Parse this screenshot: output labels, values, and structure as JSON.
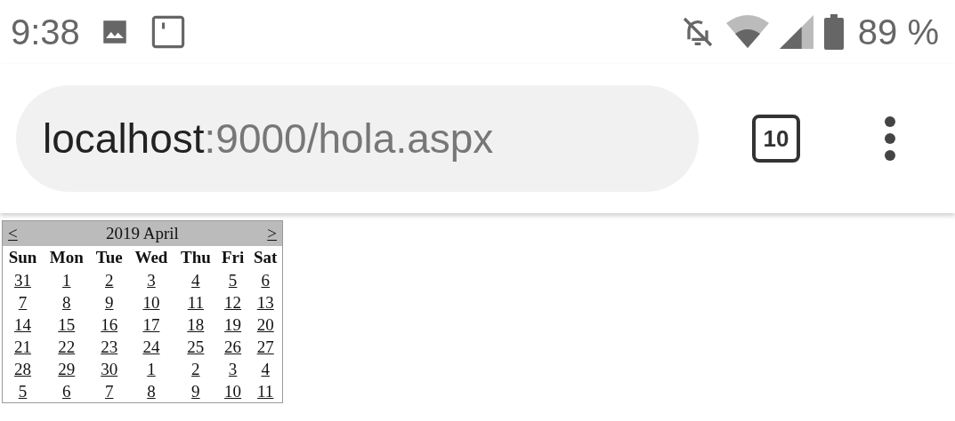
{
  "status_bar": {
    "time": "9:38",
    "battery": "89 %"
  },
  "address_bar": {
    "host": "localhost",
    "path": ":9000/hola.aspx",
    "tab_count": "10"
  },
  "calendar": {
    "prev": "<",
    "title": "2019 April",
    "next": ">",
    "weekdays": [
      "Sun",
      "Mon",
      "Tue",
      "Wed",
      "Thu",
      "Fri",
      "Sat"
    ],
    "weeks": [
      [
        "31",
        "1",
        "2",
        "3",
        "4",
        "5",
        "6"
      ],
      [
        "7",
        "8",
        "9",
        "10",
        "11",
        "12",
        "13"
      ],
      [
        "14",
        "15",
        "16",
        "17",
        "18",
        "19",
        "20"
      ],
      [
        "21",
        "22",
        "23",
        "24",
        "25",
        "26",
        "27"
      ],
      [
        "28",
        "29",
        "30",
        "1",
        "2",
        "3",
        "4"
      ],
      [
        "5",
        "6",
        "7",
        "8",
        "9",
        "10",
        "11"
      ]
    ]
  }
}
